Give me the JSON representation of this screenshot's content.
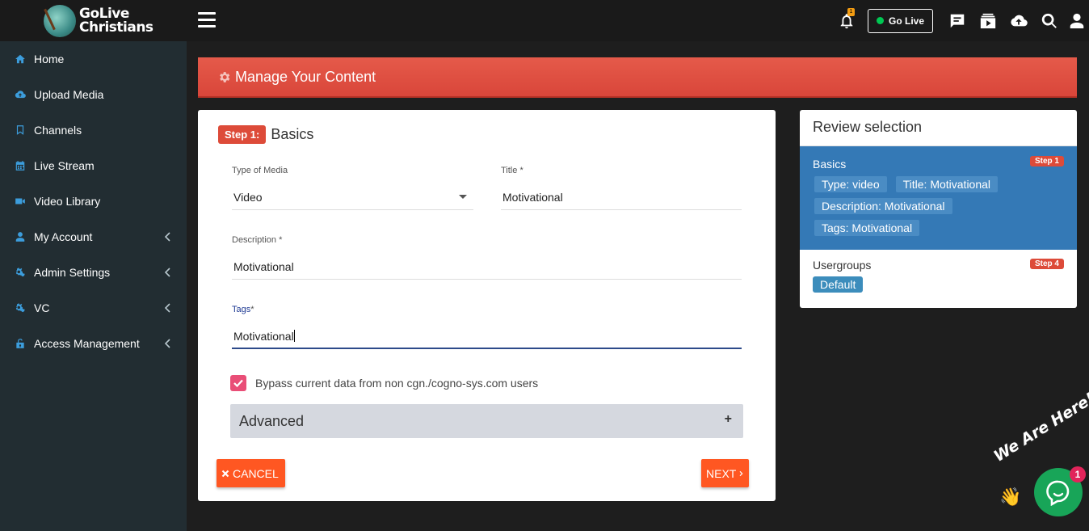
{
  "brand": {
    "line1": "GoLive",
    "line2": "Christians"
  },
  "topbar": {
    "notification_count": "1",
    "golive_label": "Go Live"
  },
  "sidebar": {
    "items": [
      {
        "label": "Home",
        "icon": "home-icon"
      },
      {
        "label": "Upload Media",
        "icon": "cloud-upload-icon"
      },
      {
        "label": "Channels",
        "icon": "bookmark-icon"
      },
      {
        "label": "Live Stream",
        "icon": "calendar-icon"
      },
      {
        "label": "Video Library",
        "icon": "video-camera-icon"
      },
      {
        "label": "My Account",
        "icon": "user-icon"
      },
      {
        "label": "Admin Settings",
        "icon": "cogs-icon"
      },
      {
        "label": "VC",
        "icon": "cogs-icon"
      },
      {
        "label": "Access Management",
        "icon": "unlock-icon"
      }
    ]
  },
  "banner": {
    "title": "Manage Your Content"
  },
  "form": {
    "step_badge": "Step 1:",
    "step_title": "Basics",
    "type_of_media": {
      "label": "Type of Media",
      "value": "Video"
    },
    "title": {
      "label": "Title",
      "value": "Motivational"
    },
    "description": {
      "label": "Description",
      "value": "Motivational"
    },
    "tags": {
      "label": "Tags",
      "value": "Motivational"
    },
    "required_marker": "*",
    "bypass_label": "Bypass current data from non cgn./cogno-sys.com users",
    "bypass_checked": true,
    "advanced_label": "Advanced",
    "advanced_toggle": "+",
    "cancel_label": "CANCEL",
    "next_label": "NEXT"
  },
  "review": {
    "title": "Review selection",
    "basics": {
      "title": "Basics",
      "step": "Step 1",
      "chips": [
        "Type: video",
        "Title: Motivational",
        "Description: Motivational",
        "Tags: Motivational"
      ]
    },
    "usergroups": {
      "title": "Usergroups",
      "step": "Step 4",
      "chip": "Default"
    }
  },
  "chat_widget": {
    "tagline": "We Are Here!",
    "unread": "1"
  },
  "colors": {
    "accent_red": "#dd4b39",
    "button_orange": "#ff5722",
    "review_blue": "#3479b6",
    "checkbox_pink": "#e94e77",
    "chat_green": "#18a558"
  }
}
